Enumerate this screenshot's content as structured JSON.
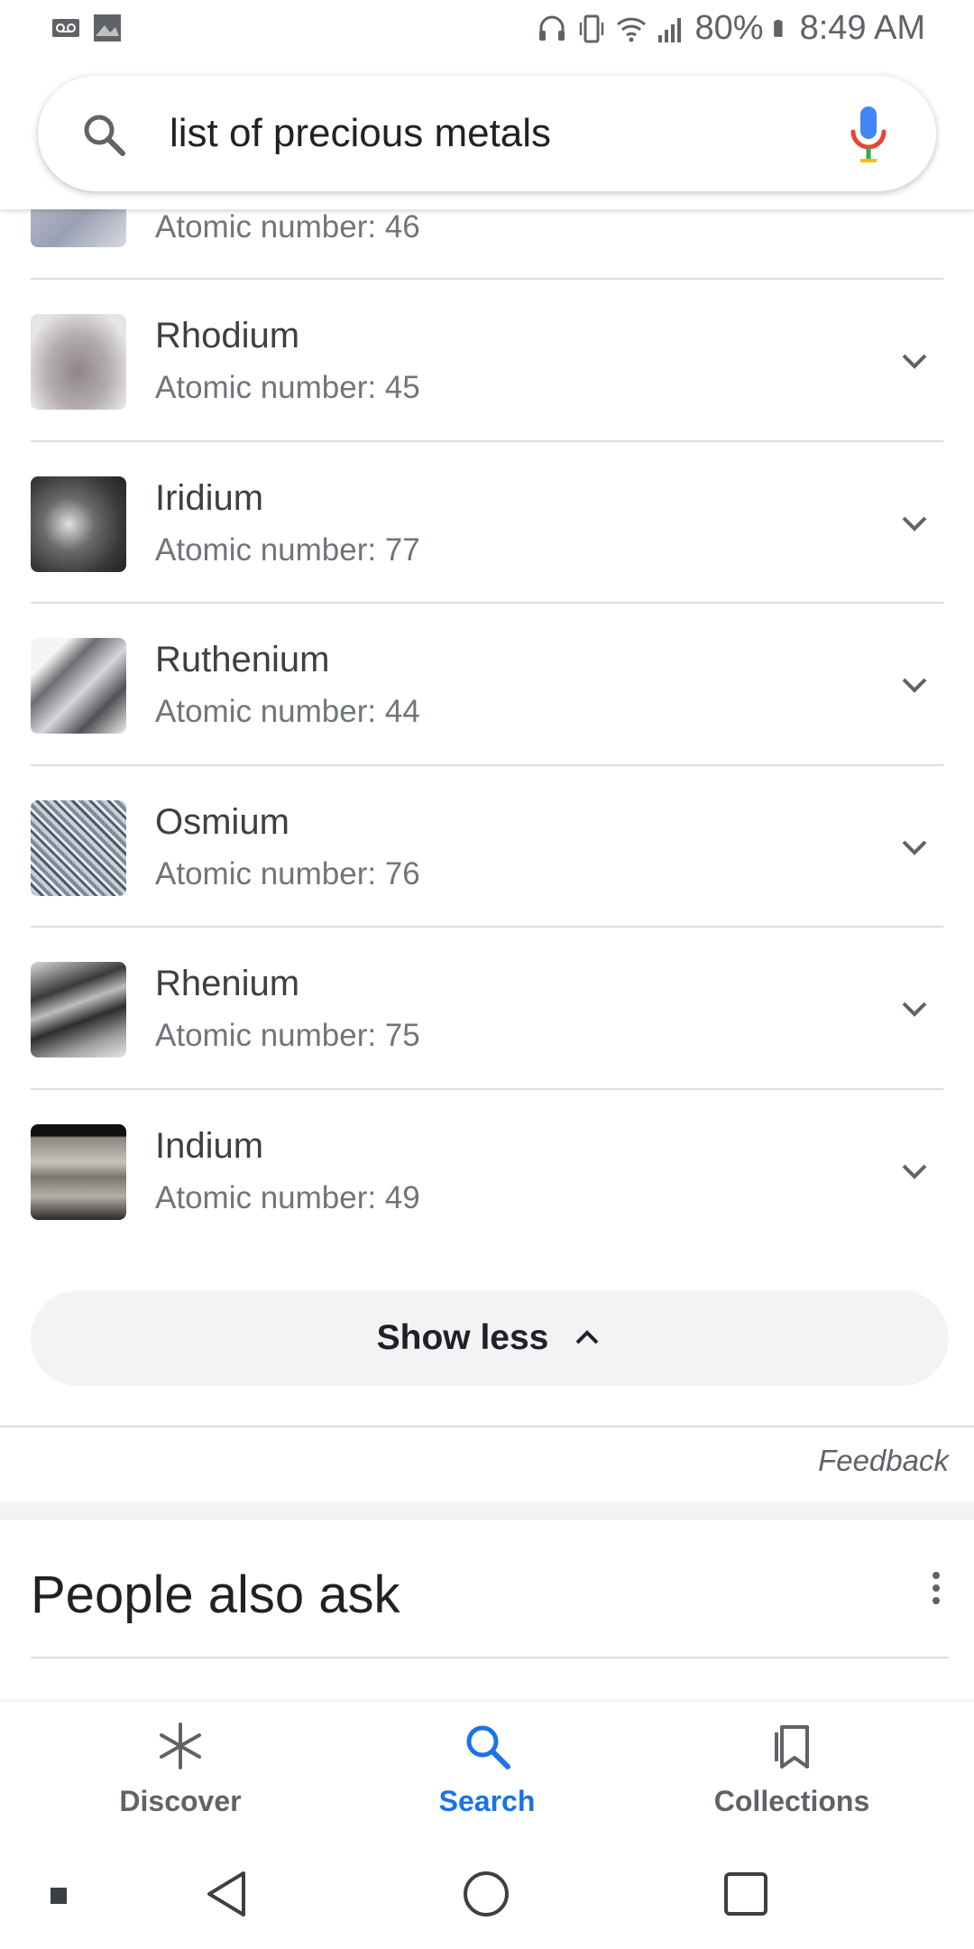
{
  "status_bar": {
    "battery": "80%",
    "time": "8:49 AM"
  },
  "search": {
    "query": "list of precious metals"
  },
  "results": [
    {
      "name": "",
      "atomic": "Atomic number: 46",
      "thumb": "palladium"
    },
    {
      "name": "Rhodium",
      "atomic": "Atomic number: 45",
      "thumb": "rhodium"
    },
    {
      "name": "Iridium",
      "atomic": "Atomic number: 77",
      "thumb": "iridium"
    },
    {
      "name": "Ruthenium",
      "atomic": "Atomic number: 44",
      "thumb": "ruthenium"
    },
    {
      "name": "Osmium",
      "atomic": "Atomic number: 76",
      "thumb": "osmium"
    },
    {
      "name": "Rhenium",
      "atomic": "Atomic number: 75",
      "thumb": "rhenium"
    },
    {
      "name": "Indium",
      "atomic": "Atomic number: 49",
      "thumb": "indium"
    }
  ],
  "show_less_label": "Show less",
  "feedback_label": "Feedback",
  "people_also_ask": {
    "title": "People also ask"
  },
  "bottom_nav": {
    "discover": "Discover",
    "search": "Search",
    "collections": "Collections"
  },
  "colors": {
    "accent": "#1a73e8",
    "text": "#202124",
    "secondary": "#70757a",
    "divider": "#dadce0"
  }
}
